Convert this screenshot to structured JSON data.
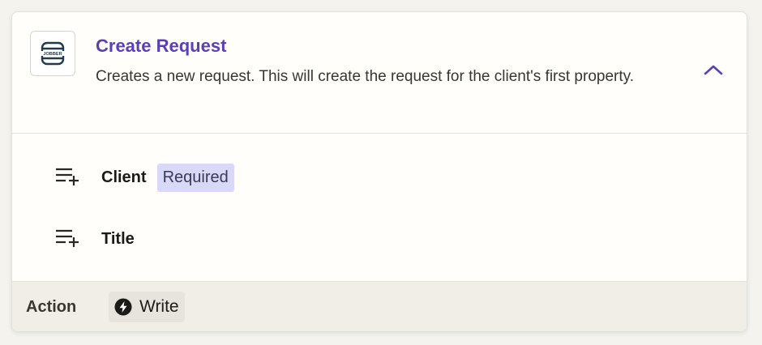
{
  "step": {
    "title": "Create Request",
    "description": "Creates a new request. This will create the request for the client's first property.",
    "app_icon": "jobber-logo",
    "expanded_icon": "chevron-up-icon",
    "accent_color": "#5b3fb6"
  },
  "fields": [
    {
      "label": "Client",
      "badge": "Required",
      "icon": "playlist-add-icon"
    },
    {
      "label": "Title",
      "icon": "playlist-add-icon"
    }
  ],
  "footer": {
    "label": "Action",
    "type_label": "Write",
    "type_icon": "bolt-icon"
  }
}
